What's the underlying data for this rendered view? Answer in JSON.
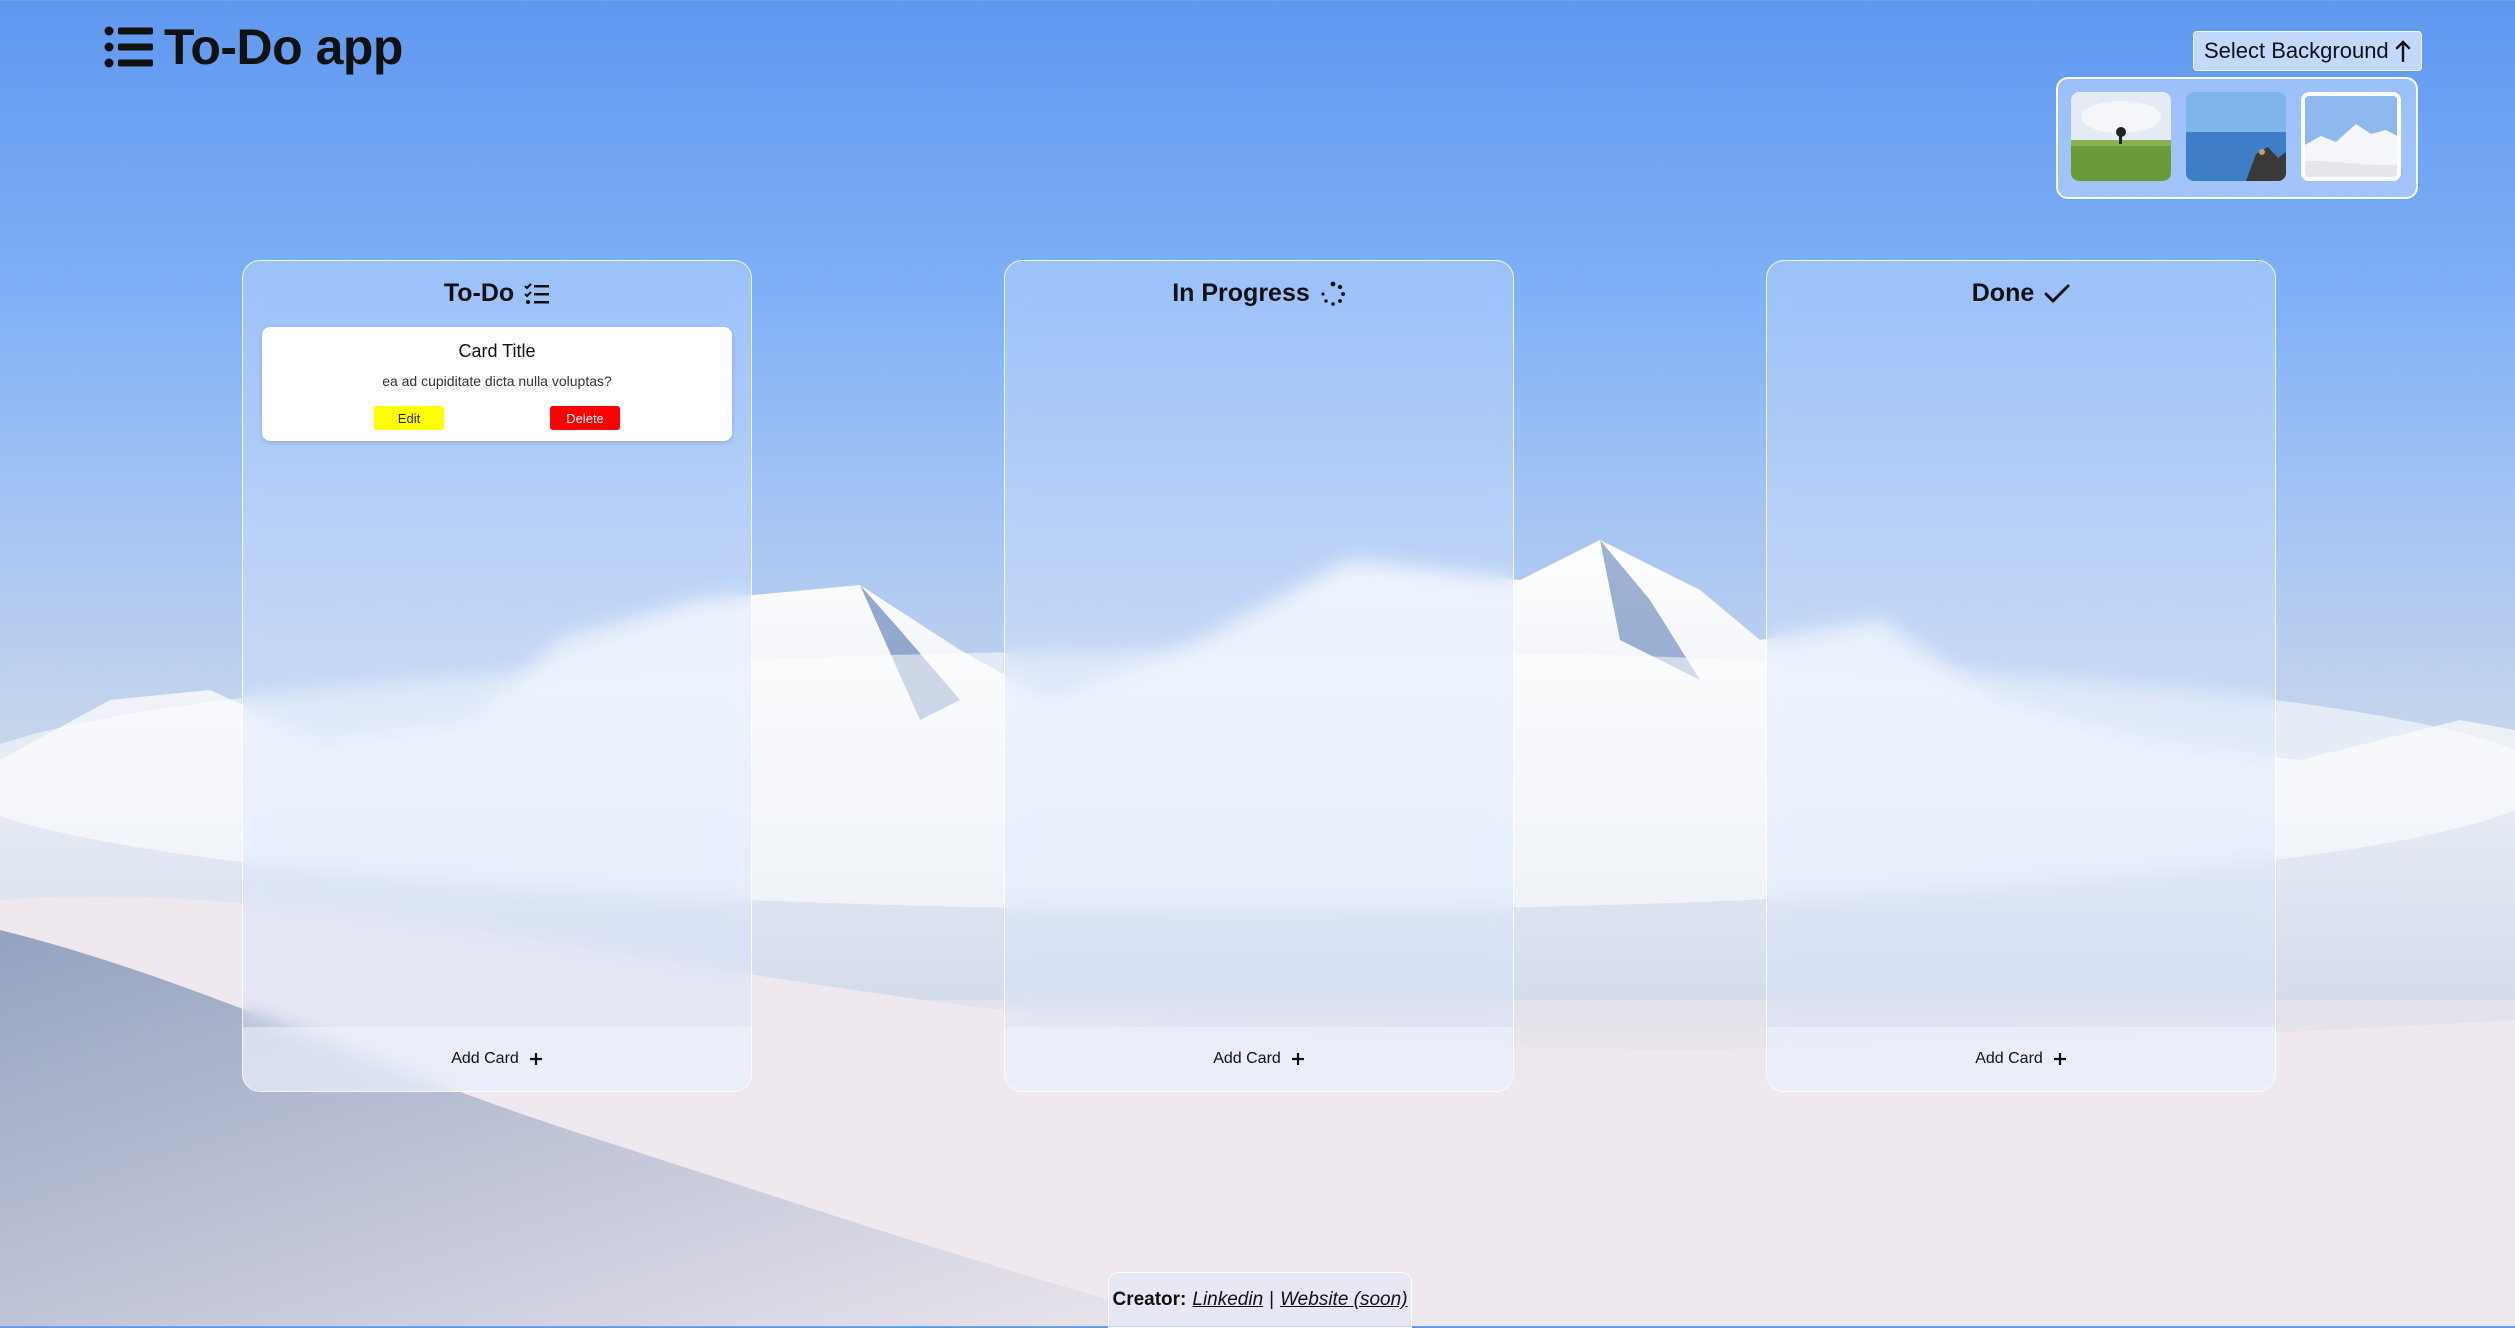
{
  "app": {
    "title": "To-Do app"
  },
  "background_selector": {
    "label": "Select Background",
    "options": [
      {
        "name": "field-tree",
        "selected": false
      },
      {
        "name": "sea-rocks",
        "selected": false
      },
      {
        "name": "snow-mountains",
        "selected": true
      }
    ]
  },
  "columns": [
    {
      "title": "To-Do",
      "icon": "checklist-icon",
      "add_label": "Add Card",
      "cards": [
        {
          "title": "Card Title",
          "description": "ea ad cupiditate dicta nulla voluptas?",
          "edit_label": "Edit",
          "delete_label": "Delete"
        }
      ]
    },
    {
      "title": "In Progress",
      "icon": "spinner-icon",
      "add_label": "Add Card",
      "cards": []
    },
    {
      "title": "Done",
      "icon": "check-icon",
      "add_label": "Add Card",
      "cards": []
    }
  ],
  "footer": {
    "creator_label": "Creator:",
    "linkedin_label": "Linkedin",
    "separator": "|",
    "website_label": "Website (soon)"
  },
  "colors": {
    "edit_button": "#ffff00",
    "delete_button": "#ff0000"
  }
}
